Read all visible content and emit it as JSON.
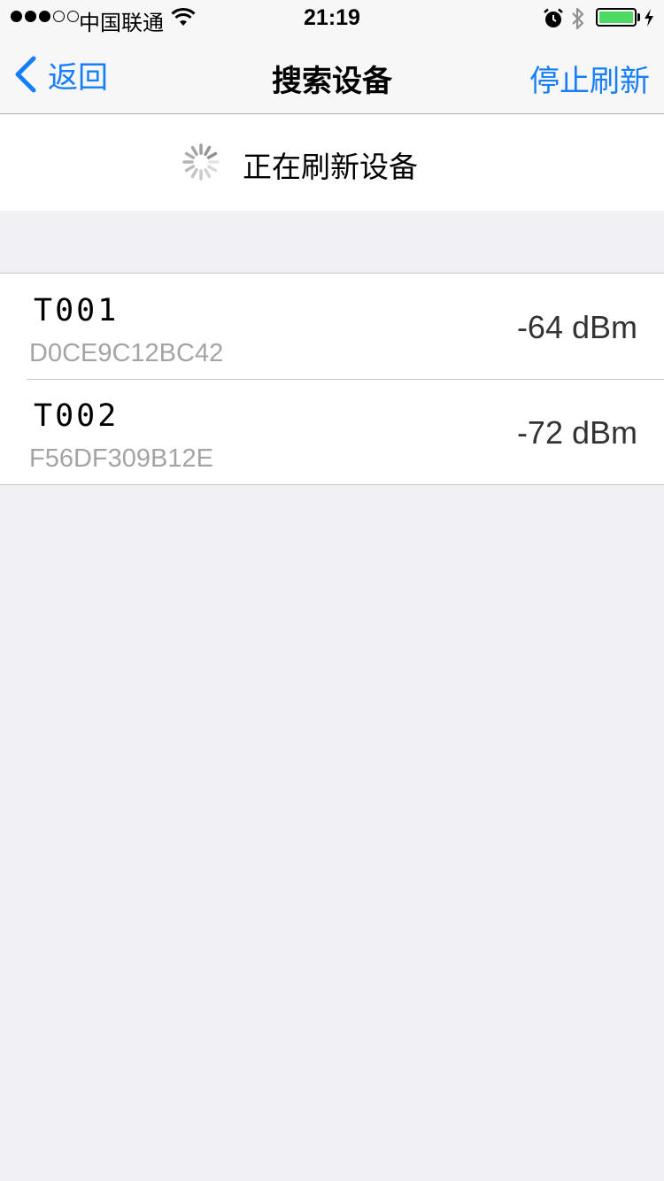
{
  "status_bar": {
    "carrier": "中国联通",
    "time": "21:19",
    "signal_bars_filled": 3,
    "signal_bars_total": 5,
    "battery_level": 1.0,
    "battery_color": "#4cd964"
  },
  "nav": {
    "back_label": "返回",
    "title": "搜索设备",
    "action_label": "停止刷新",
    "tint_color": "#157efb"
  },
  "refresh": {
    "text": "正在刷新设备"
  },
  "devices": [
    {
      "name": "T001",
      "mac": "D0CE9C12BC42",
      "rssi": "-64 dBm"
    },
    {
      "name": "T002",
      "mac": "F56DF309B12E",
      "rssi": "-72 dBm"
    }
  ],
  "icons": {
    "back": "chevron-left-icon",
    "wifi": "wifi-icon",
    "alarm": "alarm-clock-icon",
    "bluetooth": "bluetooth-icon",
    "battery": "battery-icon",
    "charging": "charging-bolt-icon",
    "spinner": "activity-spinner-icon"
  }
}
